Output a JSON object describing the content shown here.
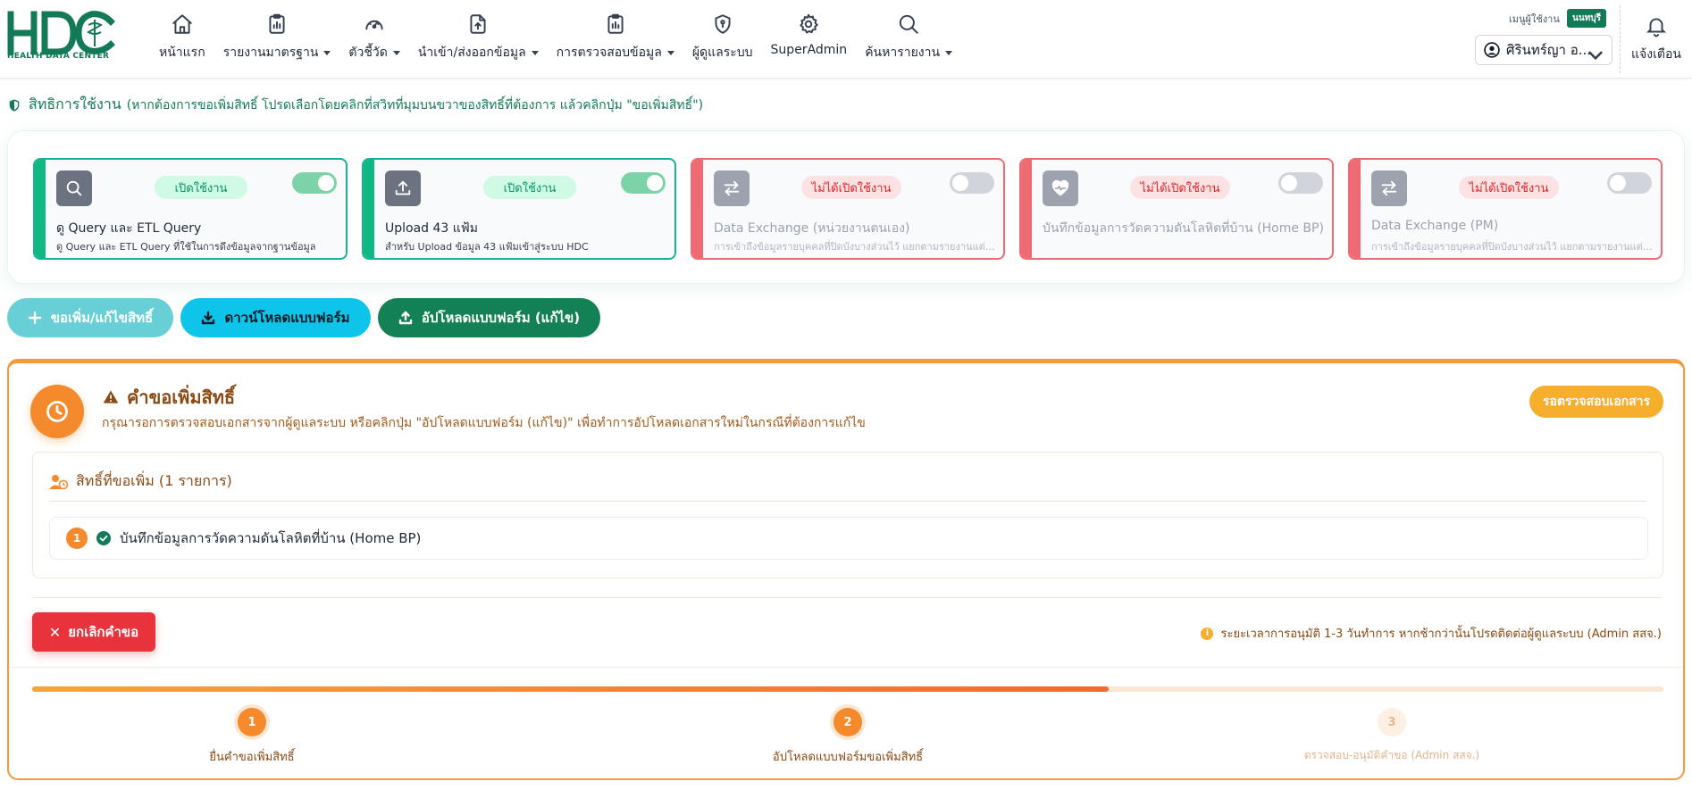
{
  "header": {
    "logo_text": "HDC",
    "logo_subtitle": "HEALTH DATA CENTER",
    "nav": [
      {
        "label": "หน้าแรก",
        "icon": "home-icon",
        "dropdown": false
      },
      {
        "label": "รายงานมาตรฐาน",
        "icon": "clipboard-report-icon",
        "dropdown": true
      },
      {
        "label": "ตัวชี้วัด",
        "icon": "gauge-icon",
        "dropdown": true
      },
      {
        "label": "นำเข้า/ส่งออกข้อมูล",
        "icon": "file-upload-icon",
        "dropdown": true
      },
      {
        "label": "การตรวจสอบข้อมูล",
        "icon": "clipboard-check-icon",
        "dropdown": true
      },
      {
        "label": "ผู้ดูแลระบบ",
        "icon": "shield-key-icon",
        "dropdown": false
      },
      {
        "label": "SuperAdmin",
        "icon": "gear-icon",
        "dropdown": false
      },
      {
        "label": "ค้นหารายงาน",
        "icon": "search-icon",
        "dropdown": true
      }
    ],
    "user_menu_label": "เมนูผู้ใช้งาน",
    "province_badge": "นนทบุรี",
    "user_name": "ศิรินทร์ญา อ...",
    "notifications_label": "แจ้งเตือน"
  },
  "permissions": {
    "title": "สิทธิการใช้งาน",
    "hint": "(หากต้องการขอเพิ่มสิทธิ์ โปรดเลือกโดยคลิกที่สวิทที่มุมบนขวาของสิทธิ์ที่ต้องการ แล้วคลิกปุ่ม \"ขอเพิ่มสิทธิ์\")",
    "cards": [
      {
        "title": "ดู Query และ ETL Query",
        "description": "ดู Query และ ETL Query ที่ใช้ในการดึงข้อมูลจากฐานข้อมูล",
        "status": "เปิดใช้งาน",
        "enabled": true,
        "icon": "search-icon"
      },
      {
        "title": "Upload 43 แฟ้ม",
        "description": "สำหรับ Upload ข้อมูล 43 แฟ้มเข้าสู่ระบบ HDC",
        "status": "เปิดใช้งาน",
        "enabled": true,
        "icon": "upload-icon"
      },
      {
        "title": "Data Exchange (หน่วยงานตนเอง)",
        "description": "การเข้าถึงข้อมูลรายบุคคลที่ปิดบังบางส่วนไว้ แยกตามรายงานแต่ละเ...",
        "status": "ไม่ได้เปิดใช้งาน",
        "enabled": false,
        "icon": "exchange-icon"
      },
      {
        "title": "บันทึกข้อมูลการวัดความดันโลหิตที่บ้าน (Home BP)",
        "description": "",
        "status": "ไม่ได้เปิดใช้งาน",
        "enabled": false,
        "icon": "heart-pulse-icon"
      },
      {
        "title": "Data Exchange (PM)",
        "description": "การเข้าถึงข้อมูลรายบุคคลที่ปิดบังบางส่วนไว้ แยกตามรายงานแต่ละเ...",
        "status": "ไม่ได้เปิดใช้งาน",
        "enabled": false,
        "icon": "exchange-icon"
      }
    ]
  },
  "actions": {
    "request_label": "ขอเพิ่ม/แก้ไขสิทธิ์",
    "download_label": "ดาวน์โหลดแบบฟอร์ม",
    "upload_label": "อัปโหลดแบบฟอร์ม (แก้ไข)"
  },
  "request": {
    "title": "คำขอเพิ่มสิทธิ์",
    "subtitle": "กรุณารอการตรวจสอบเอกสารจากผู้ดูแลระบบ หรือคลิกปุ่ม \"อัปโหลดแบบฟอร์ม (แก้ไข)\" เพื่อทำการอัปโหลดเอกสารใหม่ในกรณีที่ต้องการแก้ไข",
    "status_badge": "รอตรวจสอบเอกสาร",
    "list_title": "สิทธิ์ที่ขอเพิ่ม (1 รายการ)",
    "items": [
      {
        "number": "1",
        "label": "บันทึกข้อมูลการวัดความดันโลหิตที่บ้าน (Home BP)"
      }
    ],
    "cancel_label": "ยกเลิกคำขอ",
    "note": "ระยะเวลาการอนุมัติ 1-3 วันทำการ หากช้ากว่านั้นโปรดติดต่อผู้ดูแลระบบ (Admin สสจ.)",
    "progress_fraction": 0.66,
    "steps": [
      {
        "number": "1",
        "label": "ยื่นคำขอเพิ่มสิทธิ์",
        "state": "done"
      },
      {
        "number": "2",
        "label": "อัปโหลดแบบฟอร์มขอเพิ่มสิทธิ์",
        "state": "current"
      },
      {
        "number": "3",
        "label": "ตรวจสอบ-อนุมัติคำขอ (Admin สสจ.)",
        "state": "pending"
      }
    ]
  },
  "colors": {
    "brand_green": "#137a57",
    "accent_orange": "#f58a2c",
    "enabled_teal": "#16b39a",
    "disabled_red": "#ef6b73"
  }
}
